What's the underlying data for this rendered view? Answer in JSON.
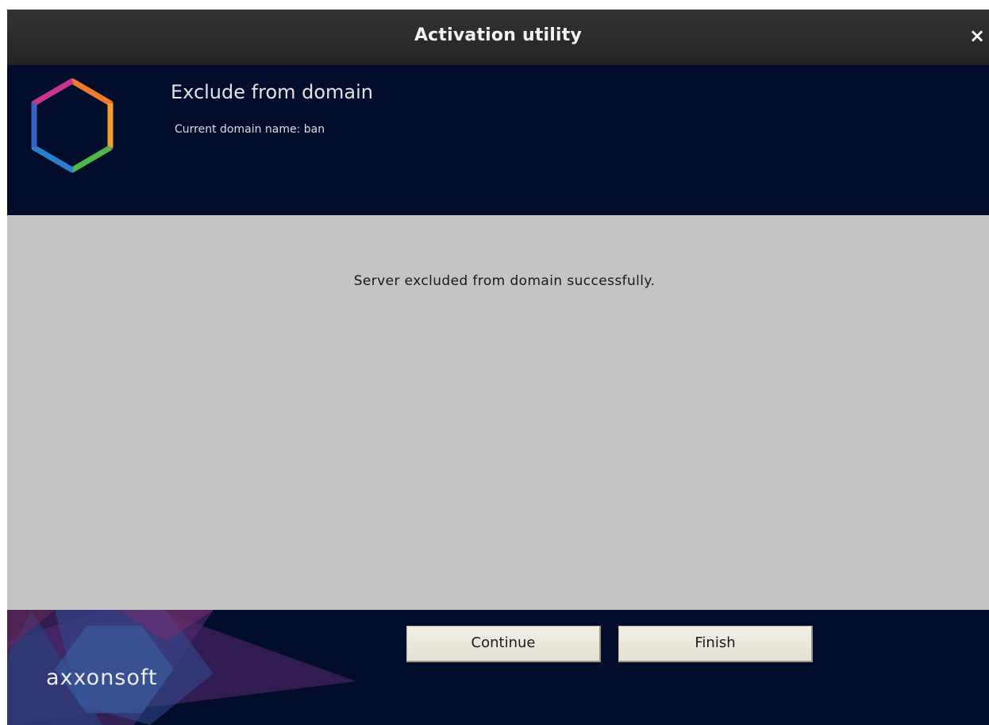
{
  "window": {
    "title": "Activation utility",
    "close_glyph": "×"
  },
  "header": {
    "heading": "Exclude from domain",
    "subheading": "Current domain name: ban",
    "logo_icon": "hexagon-logo-icon"
  },
  "content": {
    "message": "Server excluded from domain successfully."
  },
  "footer": {
    "brand": "axxonsoft",
    "buttons": {
      "continue_label": "Continue",
      "finish_label": "Finish"
    }
  },
  "colors": {
    "titlebar": "#2b2b2b",
    "header_bg": "#020d2b",
    "content_bg": "#c4c4c4",
    "button_bg": "#ece9dd"
  }
}
